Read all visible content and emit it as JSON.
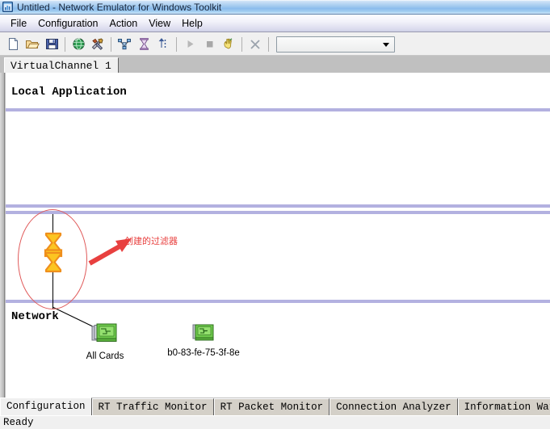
{
  "window": {
    "title": "Untitled - Network Emulator for Windows Toolkit",
    "icon": "app-chart-window-icon"
  },
  "menubar": {
    "items": [
      {
        "label": "File"
      },
      {
        "label": "Configuration"
      },
      {
        "label": "Action"
      },
      {
        "label": "View"
      },
      {
        "label": "Help"
      }
    ]
  },
  "toolbar": {
    "buttons": [
      {
        "name": "new-document-icon",
        "title": "New"
      },
      {
        "name": "open-folder-icon",
        "title": "Open"
      },
      {
        "name": "save-disk-icon",
        "title": "Save"
      },
      {
        "name": "globe-icon",
        "title": "Network"
      },
      {
        "name": "tools-hammer-wrench-icon",
        "title": "Tools"
      },
      {
        "name": "topology-tree-icon",
        "title": "Topology"
      },
      {
        "name": "hourglass-filter-icon",
        "title": "Filter"
      },
      {
        "name": "updown-arrows-icon",
        "title": "Move"
      },
      {
        "name": "play-start-icon",
        "title": "Start"
      },
      {
        "name": "stop-square-icon",
        "title": "Stop"
      },
      {
        "name": "pause-hand-icon",
        "title": "Pause"
      },
      {
        "name": "scissors-cut-icon",
        "title": "Cut"
      }
    ],
    "combo": {
      "value": "",
      "placeholder": ""
    }
  },
  "channel_tabs": {
    "tabs": [
      {
        "label": "VirtualChannel 1",
        "selected": true
      }
    ]
  },
  "diagram": {
    "zones": [
      {
        "label": "Local Application"
      },
      {
        "label": "Network"
      }
    ],
    "filter_node": {
      "icon": "hourglass-filter-icon",
      "highlighted": true
    },
    "annotation": {
      "text": "创建的过滤器",
      "color": "#e8403f",
      "arrow": "red-arrow-icon"
    },
    "nodes": [
      {
        "label": "All Cards",
        "icon": "network-cards-stack-icon"
      },
      {
        "label": "b0-83-fe-75-3f-8e",
        "icon": "network-card-icon"
      }
    ]
  },
  "bottom_tabs": {
    "tabs": [
      {
        "label": "Configuration",
        "selected": true
      },
      {
        "label": "RT Traffic Monitor",
        "selected": false
      },
      {
        "label": "RT Packet Monitor",
        "selected": false
      },
      {
        "label": "Connection Analyzer",
        "selected": false
      },
      {
        "label": "Information Watch",
        "selected": false
      }
    ]
  },
  "statusbar": {
    "text": "Ready"
  }
}
